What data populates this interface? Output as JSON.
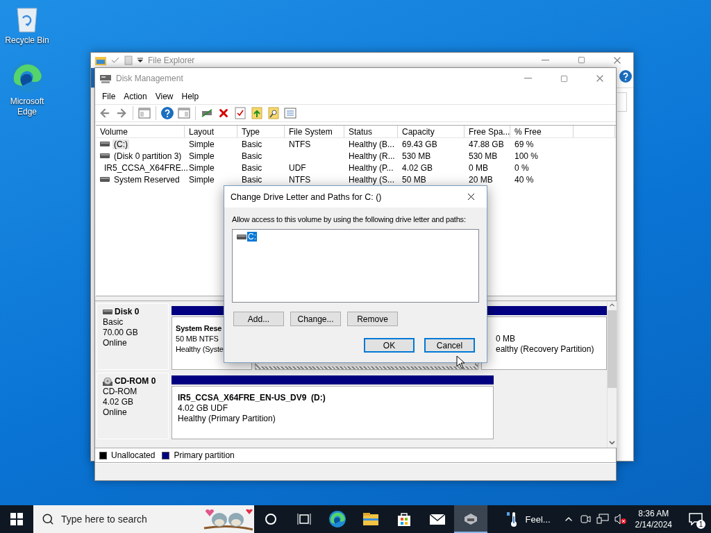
{
  "desktop_icons": [
    {
      "label": "Recycle Bin",
      "kind": "recycle"
    },
    {
      "label": "Microsoft Edge",
      "kind": "edge"
    }
  ],
  "explorer_window": {
    "title": "File Explorer"
  },
  "disk_management": {
    "title": "Disk Management",
    "menu": [
      "File",
      "Action",
      "View",
      "Help"
    ],
    "volume_table": {
      "columns": [
        "Volume",
        "Layout",
        "Type",
        "File System",
        "Status",
        "Capacity",
        "Free Spa...",
        "% Free"
      ],
      "rows": [
        {
          "kind": "disk",
          "selected": true,
          "cells": [
            "(C:)",
            "Simple",
            "Basic",
            "NTFS",
            "Healthy (B...",
            "69.43 GB",
            "47.88 GB",
            "69 %"
          ]
        },
        {
          "kind": "disk",
          "selected": false,
          "cells": [
            "(Disk 0 partition 3)",
            "Simple",
            "Basic",
            "",
            "Healthy (R...",
            "530 MB",
            "530 MB",
            "100 %"
          ]
        },
        {
          "kind": "cdrom",
          "selected": false,
          "cells": [
            "IR5_CCSA_X64FRE...",
            "Simple",
            "Basic",
            "UDF",
            "Healthy (P...",
            "4.02 GB",
            "0 MB",
            "0 %"
          ]
        },
        {
          "kind": "disk",
          "selected": false,
          "cells": [
            "System Reserved",
            "Simple",
            "Basic",
            "NTFS",
            "Healthy (S...",
            "50 MB",
            "20 MB",
            "40 %"
          ]
        }
      ]
    },
    "disks": [
      {
        "kind": "disk",
        "name": "Disk 0",
        "type": "Basic",
        "size": "70.00 GB",
        "status": "Online",
        "partitions": [
          {
            "selected": false,
            "name": "System Rese",
            "details": "50 MB NTFS",
            "health": "Healthy (Syste"
          },
          {
            "selected": true
          },
          {
            "selected": false,
            "details": "0 MB",
            "health": "ealthy (Recovery Partition)"
          }
        ]
      },
      {
        "kind": "cdrom",
        "name": "CD-ROM 0",
        "type": "CD-ROM",
        "size": "4.02 GB",
        "status": "Online",
        "partitions": [
          {
            "selected": false,
            "name": "IR5_CCSA_X64FRE_EN-US_DV9  (D:)",
            "details": "4.02 GB UDF",
            "health": "Healthy (Primary Partition)"
          }
        ]
      }
    ],
    "legend": [
      {
        "label": "Unallocated",
        "color": "#000000"
      },
      {
        "label": "Primary partition",
        "color": "#000080"
      }
    ]
  },
  "dialog": {
    "title": "Change Drive Letter and Paths for C: ()",
    "instruction": "Allow access to this volume by using the following drive letter and paths:",
    "paths": [
      {
        "label": "C:",
        "selected": true
      }
    ],
    "buttons": [
      {
        "label": "Add...",
        "default": false
      },
      {
        "label": "Change...",
        "default": false
      },
      {
        "label": "Remove",
        "default": false
      }
    ],
    "dialog_buttons": [
      {
        "label": "OK",
        "default": true
      },
      {
        "label": "Cancel",
        "default": true
      }
    ]
  },
  "taskbar": {
    "search_placeholder": "Type here to search",
    "apps": [
      {
        "kind": "cortana",
        "active": false
      },
      {
        "kind": "taskview",
        "active": false
      },
      {
        "kind": "edge",
        "active": false
      },
      {
        "kind": "folder",
        "active": false
      },
      {
        "kind": "store",
        "active": false
      },
      {
        "kind": "mail",
        "active": false
      },
      {
        "kind": "disk",
        "active": true
      }
    ],
    "weather": "Feel...",
    "time": "8:36 AM",
    "date": "2/14/2024",
    "notifications": "1"
  }
}
